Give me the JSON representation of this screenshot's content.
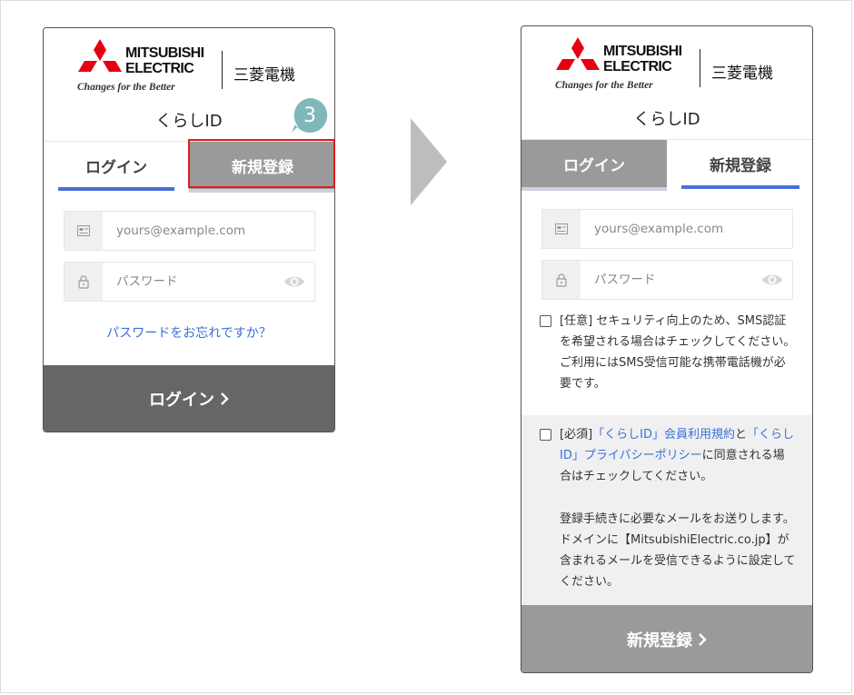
{
  "brand": {
    "name_en_line1": "MITSUBISHI",
    "name_en_line2": "ELECTRIC",
    "tagline": "Changes for the Better",
    "name_jp": "三菱電機",
    "logo_color": "#e60012",
    "service_name": "くらしID"
  },
  "tabs": {
    "login": "ログイン",
    "register": "新規登録"
  },
  "form": {
    "email_placeholder": "yours@example.com",
    "password_placeholder": "パスワード"
  },
  "login_panel": {
    "forgot_password": "パスワードをお忘れですか？",
    "submit_label": "ログイン",
    "step_badge": "3"
  },
  "register_panel": {
    "sms_prefix": "[任意]",
    "sms_text": "セキュリティ向上のため、SMS認証を希望される場合はチェックしてください。ご利用にはSMS受信可能な携帯電話機が必要です。",
    "terms_prefix": "[必須]",
    "terms_link1": "「くらしID」会員利用規約",
    "terms_and": "と",
    "terms_link2": "「くらしID」プライバシーポリシー",
    "terms_suffix": "に同意される場合はチェックしてください。",
    "notice": "登録手続きに必要なメールをお送りします。ドメインに【MitsubishiElectric.co.jp】が含まれるメールを受信できるように設定してください。",
    "submit_label": "新規登録"
  },
  "colors": {
    "accent_blue": "#4a6fd8",
    "link_blue": "#3a6fd8",
    "highlight_red": "#e21a1a",
    "badge_teal": "#7fb8ba",
    "login_button_bg": "#666666",
    "register_button_bg": "#9a9a9a"
  },
  "icons": {
    "email": "email-card-icon",
    "password": "lock-icon",
    "show_password": "eye-icon",
    "submit": "chevron-right-icon",
    "flow": "arrow-right-icon"
  }
}
